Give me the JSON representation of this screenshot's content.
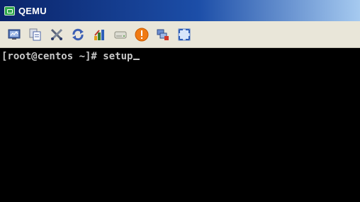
{
  "window": {
    "title": "QEMU"
  },
  "toolbar": {
    "buttons": [
      {
        "name": "monitor-icon"
      },
      {
        "name": "copy-icon"
      },
      {
        "name": "tools-icon"
      },
      {
        "name": "refresh-icon"
      },
      {
        "name": "paint-icon"
      },
      {
        "name": "drive-icon"
      },
      {
        "name": "power-icon"
      },
      {
        "name": "network-icon"
      },
      {
        "name": "fullscreen-icon"
      }
    ]
  },
  "console": {
    "prompt": "[root@centos ~]# ",
    "command": "setup"
  },
  "colors": {
    "titlebar_start": "#0a246a",
    "toolbar_bg": "#e9e6d9",
    "console_bg": "#000000",
    "console_fg": "#c8c8c8"
  }
}
